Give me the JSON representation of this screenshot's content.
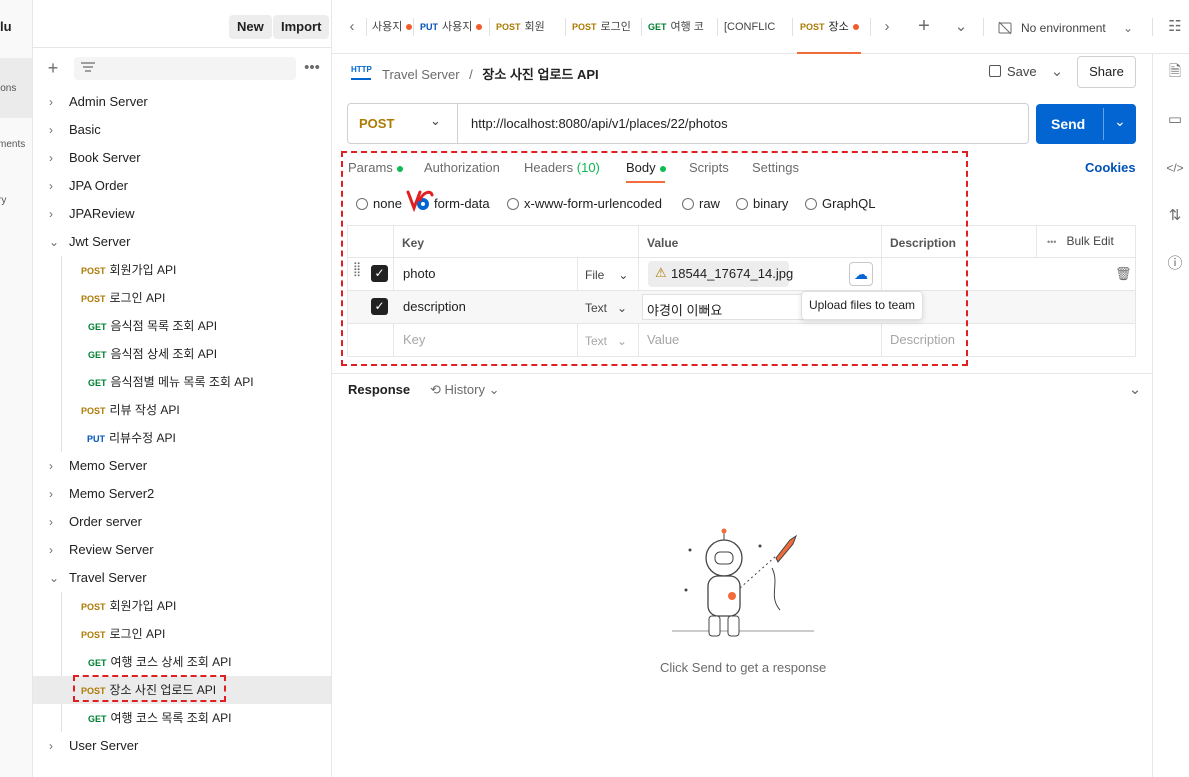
{
  "workspace": {
    "title": "lu"
  },
  "left_rail": {
    "items": [
      "ions",
      "ments",
      "ry"
    ]
  },
  "sidebar": {
    "new_label": "New",
    "import_label": "Import",
    "collections": [
      {
        "name": "Admin Server",
        "expanded": false
      },
      {
        "name": "Basic",
        "expanded": false
      },
      {
        "name": "Book Server",
        "expanded": false
      },
      {
        "name": "JPA Order",
        "expanded": false
      },
      {
        "name": "JPAReview",
        "expanded": false
      },
      {
        "name": "Jwt Server",
        "expanded": true
      },
      {
        "name": "Memo Server",
        "expanded": false
      },
      {
        "name": "Memo Server2",
        "expanded": false
      },
      {
        "name": "Order server",
        "expanded": false
      },
      {
        "name": "Review Server",
        "expanded": false
      },
      {
        "name": "Travel Server",
        "expanded": true
      },
      {
        "name": "User Server",
        "expanded": false
      }
    ],
    "jwt_requests": [
      {
        "method": "POST",
        "name": "회원가입 API"
      },
      {
        "method": "POST",
        "name": "로그인 API"
      },
      {
        "method": "GET",
        "name": "음식점 목록 조회 API"
      },
      {
        "method": "GET",
        "name": "음식점 상세 조회 API"
      },
      {
        "method": "GET",
        "name": "음식점별 메뉴 목록 조회 API"
      },
      {
        "method": "POST",
        "name": "리뷰 작성 API"
      },
      {
        "method": "PUT",
        "name": "리뷰수정 API"
      }
    ],
    "travel_requests": [
      {
        "method": "POST",
        "name": "회원가입 API"
      },
      {
        "method": "POST",
        "name": "로그인 API"
      },
      {
        "method": "GET",
        "name": "여행 코스 상세 조회 API"
      },
      {
        "method": "POST",
        "name": "장소 사진 업로드 API"
      },
      {
        "method": "GET",
        "name": "여행 코스 목록 조회 API"
      }
    ]
  },
  "tabs": [
    {
      "method": "",
      "name": "사용지"
    },
    {
      "method": "PUT",
      "name": "사용지"
    },
    {
      "method": "POST",
      "name": "회원"
    },
    {
      "method": "POST",
      "name": "로그인"
    },
    {
      "method": "GET",
      "name": "여행 코"
    },
    {
      "method": "",
      "name": "[CONFLIC"
    },
    {
      "method": "POST",
      "name": "장소"
    }
  ],
  "environment": "No environment",
  "breadcrumb": {
    "collection": "Travel Server",
    "separator": "/",
    "request": "장소 사진 업로드 API"
  },
  "save_label": "Save",
  "share_label": "Share",
  "request": {
    "method": "POST",
    "url": "http://localhost:8080/api/v1/places/22/photos",
    "send_label": "Send"
  },
  "subtabs": {
    "params": "Params",
    "authorization": "Authorization",
    "headers": "Headers",
    "headers_count": "(10)",
    "body": "Body",
    "scripts": "Scripts",
    "settings": "Settings",
    "cookies": "Cookies"
  },
  "body_types": [
    "none",
    "form-data",
    "x-www-form-urlencoded",
    "raw",
    "binary",
    "GraphQL"
  ],
  "table": {
    "headers": {
      "key": "Key",
      "value": "Value",
      "description": "Description",
      "bulk_edit": "Bulk Edit"
    },
    "rows": [
      {
        "key": "photo",
        "type": "File",
        "value": "18544_17674_14.jpg"
      },
      {
        "key": "description",
        "type": "Text",
        "value": "야경이 이뻐요"
      }
    ],
    "placeholder": {
      "key": "Key",
      "type": "Text",
      "value": "Value",
      "description": "Description"
    },
    "tooltip": "Upload files to team"
  },
  "response": {
    "title": "Response",
    "history": "History",
    "empty": "Click Send to get a response"
  },
  "colors": {
    "accent": "#0265d2",
    "post": "#ad7a03",
    "get": "#007f31",
    "put": "#0053b8",
    "highlight": "#e02020"
  }
}
